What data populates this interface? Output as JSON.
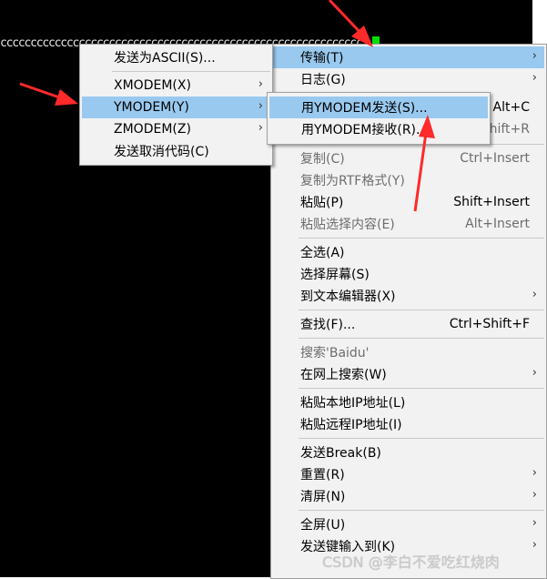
{
  "terminal": {
    "output_text": "cccccccccccccccccccccccccccccccccccccccccccccccccccccccccccc"
  },
  "main_menu": {
    "items": [
      {
        "label": "传输(T)",
        "shortcut": "",
        "submenu": true,
        "highlighted": true
      },
      {
        "label": "日志(G)",
        "shortcut": "",
        "submenu": true
      },
      {
        "label": "",
        "shortcut": "Alt+C"
      },
      {
        "label": "",
        "shortcut": "hift+R"
      },
      {
        "label": "复制(C)",
        "shortcut": "Ctrl+Insert",
        "disabled": true
      },
      {
        "label": "复制为RTF格式(Y)",
        "shortcut": "",
        "disabled": true
      },
      {
        "label": "粘贴(P)",
        "shortcut": "Shift+Insert"
      },
      {
        "label": "粘贴选择内容(E)",
        "shortcut": "Alt+Insert",
        "disabled": true
      },
      {
        "label": "全选(A)",
        "shortcut": ""
      },
      {
        "label": "选择屏幕(S)",
        "shortcut": ""
      },
      {
        "label": "到文本编辑器(X)",
        "shortcut": "",
        "submenu": true
      },
      {
        "label": "查找(F)...",
        "shortcut": "Ctrl+Shift+F"
      },
      {
        "label": "搜索'Baidu'",
        "shortcut": "",
        "disabled": true
      },
      {
        "label": "在网上搜索(W)",
        "shortcut": "",
        "submenu": true
      },
      {
        "label": "粘贴本地IP地址(L)",
        "shortcut": ""
      },
      {
        "label": "粘贴远程IP地址(I)",
        "shortcut": ""
      },
      {
        "label": "发送Break(B)",
        "shortcut": ""
      },
      {
        "label": "重置(R)",
        "shortcut": "",
        "submenu": true
      },
      {
        "label": "清屏(N)",
        "shortcut": "",
        "submenu": true
      },
      {
        "label": "全屏(U)",
        "shortcut": "",
        "submenu": true
      },
      {
        "label": "发送键输入到(K)",
        "shortcut": "",
        "submenu": true
      }
    ]
  },
  "transfer_menu": {
    "items": [
      {
        "label": "发送为ASCII(S)..."
      },
      {
        "label": "XMODEM(X)",
        "submenu": true
      },
      {
        "label": "YMODEM(Y)",
        "submenu": true,
        "highlighted": true
      },
      {
        "label": "ZMODEM(Z)",
        "submenu": true
      },
      {
        "label": "发送取消代码(C)"
      }
    ]
  },
  "ymodem_menu": {
    "items": [
      {
        "label": "用YMODEM发送(S)...",
        "highlighted": true
      },
      {
        "label": "用YMODEM接收(R)..."
      }
    ]
  },
  "submenu_arrow_glyph": "›",
  "watermark": "CSDN @李白不爱吃红烧肉",
  "annotation_color": "#ff2a2a"
}
